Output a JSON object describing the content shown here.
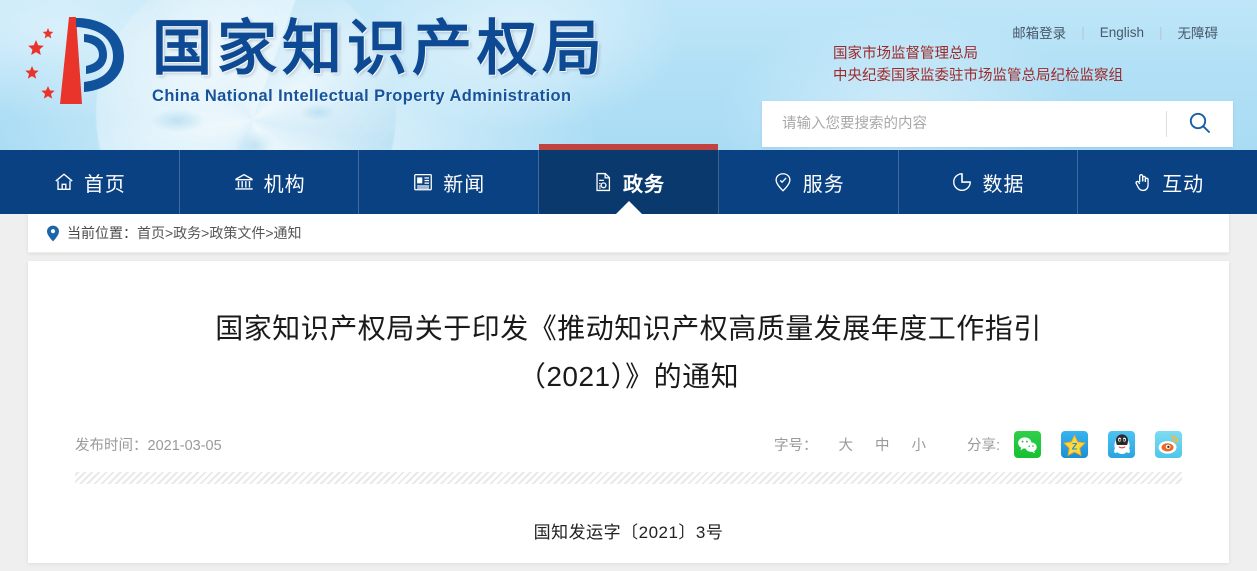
{
  "site": {
    "logo_cn": "国家知识产权局",
    "logo_en": "China National Intellectual Property Administration",
    "logo_icon": "cnipa-logo-icon"
  },
  "header": {
    "util_links": [
      {
        "label": "邮箱登录",
        "name": "mail-login-link"
      },
      {
        "label": "English",
        "name": "english-link"
      },
      {
        "label": "无障碍",
        "name": "accessibility-link"
      }
    ],
    "separator": "|",
    "org_lines": [
      "国家市场监督管理总局",
      "中央纪委国家监委驻市场监管总局纪检监察组"
    ],
    "search": {
      "placeholder": "请输入您要搜索的内容",
      "value": "",
      "button_icon": "search-icon"
    }
  },
  "nav": {
    "items": [
      {
        "label": "首页",
        "icon": "home-icon",
        "active": false
      },
      {
        "label": "机构",
        "icon": "bank-icon",
        "active": false
      },
      {
        "label": "新闻",
        "icon": "news-icon",
        "active": false
      },
      {
        "label": "政务",
        "icon": "document-icon",
        "active": true
      },
      {
        "label": "服务",
        "icon": "service-icon",
        "active": false
      },
      {
        "label": "数据",
        "icon": "chart-pie-icon",
        "active": false
      },
      {
        "label": "互动",
        "icon": "hand-icon",
        "active": false
      }
    ]
  },
  "breadcrumb": {
    "icon": "location-pin-icon",
    "prefix": "当前位置：",
    "path": "首页>政务>政策文件>通知"
  },
  "article": {
    "title": "国家知识产权局关于印发《推动知识产权高质量发展年度工作指引（2021）》的通知",
    "publish_label": "发布时间：",
    "publish_date": "2021-03-05",
    "fontsize": {
      "label": "字号：",
      "options": [
        {
          "label": "大",
          "name": "font-size-large"
        },
        {
          "label": "中",
          "name": "font-size-medium"
        },
        {
          "label": "小",
          "name": "font-size-small"
        }
      ]
    },
    "share": {
      "label": "分享:",
      "items": [
        {
          "name": "share-wechat-icon",
          "title": "微信"
        },
        {
          "name": "share-qzone-icon",
          "title": "QQ空间"
        },
        {
          "name": "share-qq-icon",
          "title": "QQ"
        },
        {
          "name": "share-weibo-icon",
          "title": "新浪微博"
        }
      ]
    },
    "doc_number": "国知发运字〔2021〕3号"
  },
  "colors": {
    "nav_bg": "#0a4182",
    "nav_active_bg": "#0a3a6d",
    "accent_red": "#c0433f",
    "logo_blue": "#0d4a93",
    "org_red": "#9c2a2a",
    "header_blue": "#b2e0f6"
  }
}
